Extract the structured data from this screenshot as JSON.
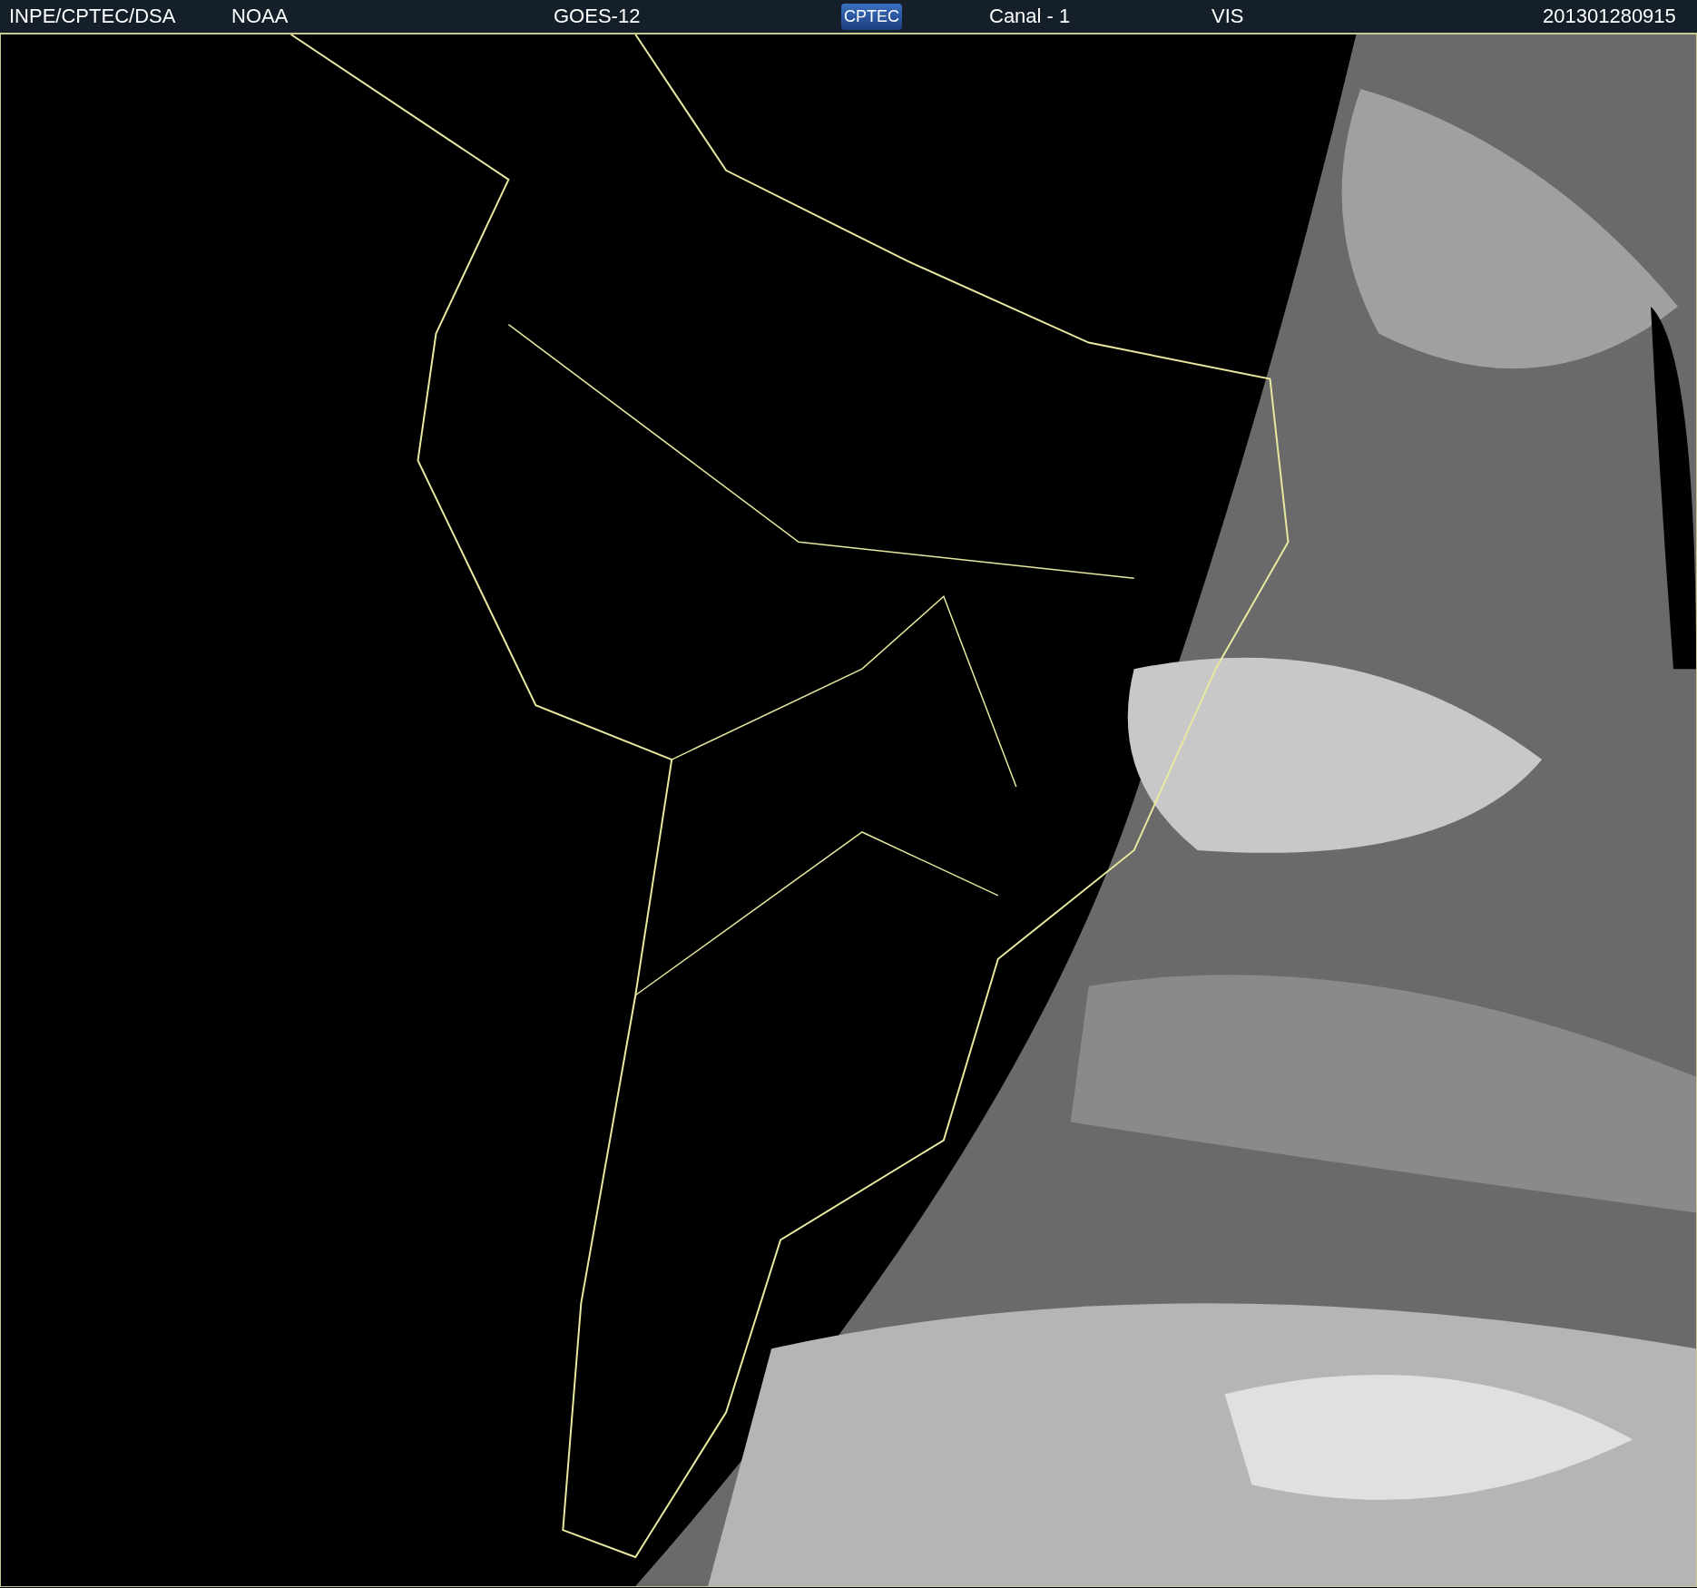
{
  "header": {
    "agency": "INPE/CPTEC/DSA",
    "source": "NOAA",
    "satellite": "GOES-12",
    "logo": "CPTEC",
    "channel": "Canal - 1",
    "band": "VIS",
    "timestamp": "201301280915"
  }
}
